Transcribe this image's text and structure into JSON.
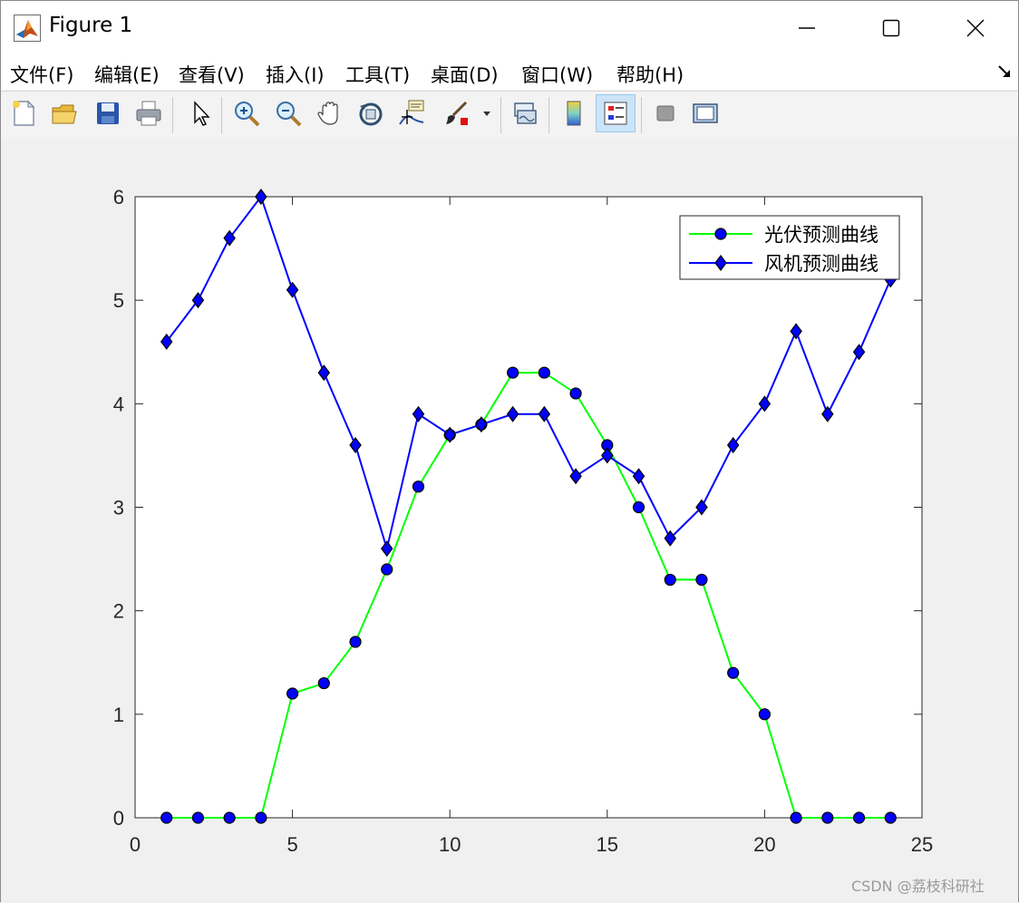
{
  "window": {
    "title": "Figure 1",
    "minimize_label": "minimize",
    "maximize_label": "maximize",
    "close_label": "close"
  },
  "menu": {
    "items": [
      {
        "label": "文件(F)"
      },
      {
        "label": "编辑(E)"
      },
      {
        "label": "查看(V)"
      },
      {
        "label": "插入(I)"
      },
      {
        "label": "工具(T)"
      },
      {
        "label": "桌面(D)"
      },
      {
        "label": "窗口(W)"
      },
      {
        "label": "帮助(H)"
      }
    ]
  },
  "toolbar": {
    "buttons": [
      {
        "icon": "new-figure-icon"
      },
      {
        "icon": "open-file-icon"
      },
      {
        "icon": "save-icon"
      },
      {
        "icon": "print-icon"
      },
      {
        "icon": "edit-plot-icon"
      },
      {
        "icon": "zoom-in-icon"
      },
      {
        "icon": "zoom-out-icon"
      },
      {
        "icon": "pan-icon"
      },
      {
        "icon": "rotate-3d-icon"
      },
      {
        "icon": "data-cursor-icon"
      },
      {
        "icon": "brush-icon"
      },
      {
        "icon": "link-plot-icon"
      },
      {
        "icon": "insert-colorbar-icon"
      },
      {
        "icon": "insert-legend-icon"
      },
      {
        "icon": "hide-plot-tools-icon"
      },
      {
        "icon": "show-plot-tools-icon"
      }
    ],
    "active_button": "insert-legend-icon"
  },
  "chart_data": {
    "type": "line",
    "title": "",
    "xlabel": "",
    "ylabel": "",
    "xlim": [
      0,
      25
    ],
    "ylim": [
      0,
      6
    ],
    "xticks": [
      "0",
      "5",
      "10",
      "15",
      "20",
      "25"
    ],
    "yticks": [
      "0",
      "1",
      "2",
      "3",
      "4",
      "5",
      "6"
    ],
    "grid": false,
    "legend_position": "top-right",
    "x": [
      1,
      2,
      3,
      4,
      5,
      6,
      7,
      8,
      9,
      10,
      11,
      12,
      13,
      14,
      15,
      16,
      17,
      18,
      19,
      20,
      21,
      22,
      23,
      24
    ],
    "series": [
      {
        "name": "光伏预测曲线",
        "color": "#00ff00",
        "marker": "circle",
        "marker_color": "#0000ff",
        "values": [
          0,
          0,
          0,
          0,
          1.2,
          1.3,
          1.7,
          2.4,
          3.2,
          3.7,
          3.8,
          4.3,
          4.3,
          4.1,
          3.6,
          3.0,
          2.3,
          2.3,
          1.4,
          1.0,
          0,
          0,
          0,
          0
        ]
      },
      {
        "name": "风机预测曲线",
        "color": "#0000ff",
        "marker": "diamond",
        "marker_color": "#0000ff",
        "values": [
          4.6,
          5.0,
          5.6,
          6.0,
          5.1,
          4.3,
          3.6,
          2.6,
          3.9,
          3.7,
          3.8,
          3.9,
          3.9,
          3.3,
          3.5,
          3.3,
          2.7,
          3.0,
          3.6,
          4.0,
          4.7,
          3.9,
          4.5,
          5.2
        ]
      }
    ]
  },
  "watermark": "CSDN @荔枝科研社"
}
